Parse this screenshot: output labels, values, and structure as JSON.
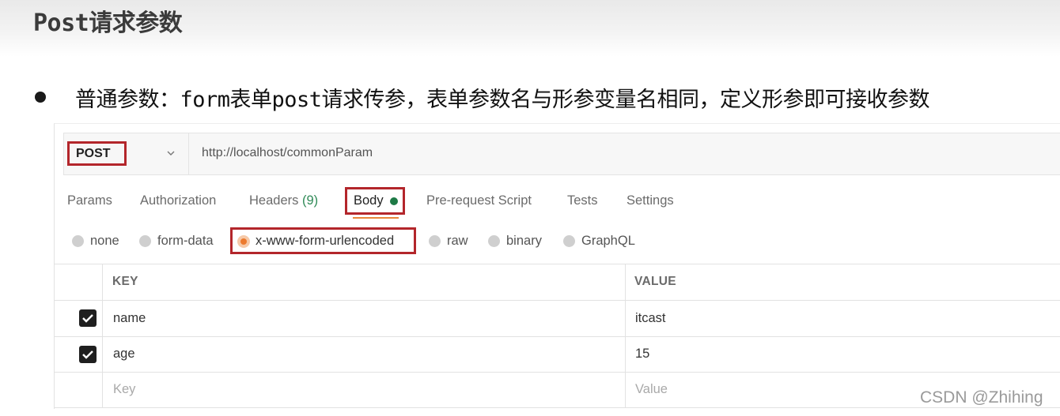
{
  "slide": {
    "title": "Post请求参数",
    "bullet": "普通参数：form表单post请求传参，表单参数名与形参变量名相同，定义形参即可接收参数"
  },
  "request": {
    "method": "POST",
    "url": "http://localhost/commonParam"
  },
  "tabs": [
    {
      "label": "Params"
    },
    {
      "label": "Authorization"
    },
    {
      "label": "Headers",
      "count": "(9)"
    },
    {
      "label": "Body",
      "active": true
    },
    {
      "label": "Pre-request Script"
    },
    {
      "label": "Tests"
    },
    {
      "label": "Settings"
    }
  ],
  "body_types": [
    {
      "label": "none"
    },
    {
      "label": "form-data"
    },
    {
      "label": "x-www-form-urlencoded",
      "selected": true
    },
    {
      "label": "raw"
    },
    {
      "label": "binary"
    },
    {
      "label": "GraphQL"
    }
  ],
  "table": {
    "headers": {
      "key": "KEY",
      "value": "VALUE"
    },
    "rows": [
      {
        "key": "name",
        "value": "itcast",
        "checked": true
      },
      {
        "key": "age",
        "value": "15",
        "checked": true
      }
    ],
    "placeholder": {
      "key": "Key",
      "value": "Value"
    }
  },
  "watermark": "CSDN @Zhihing",
  "colors": {
    "highlight_box": "#b3262b",
    "body_dot": "#1e7a46",
    "active_underline": "#e8873b",
    "radio_selected": "#ec7a2e",
    "header_count": "#2f8a57"
  }
}
